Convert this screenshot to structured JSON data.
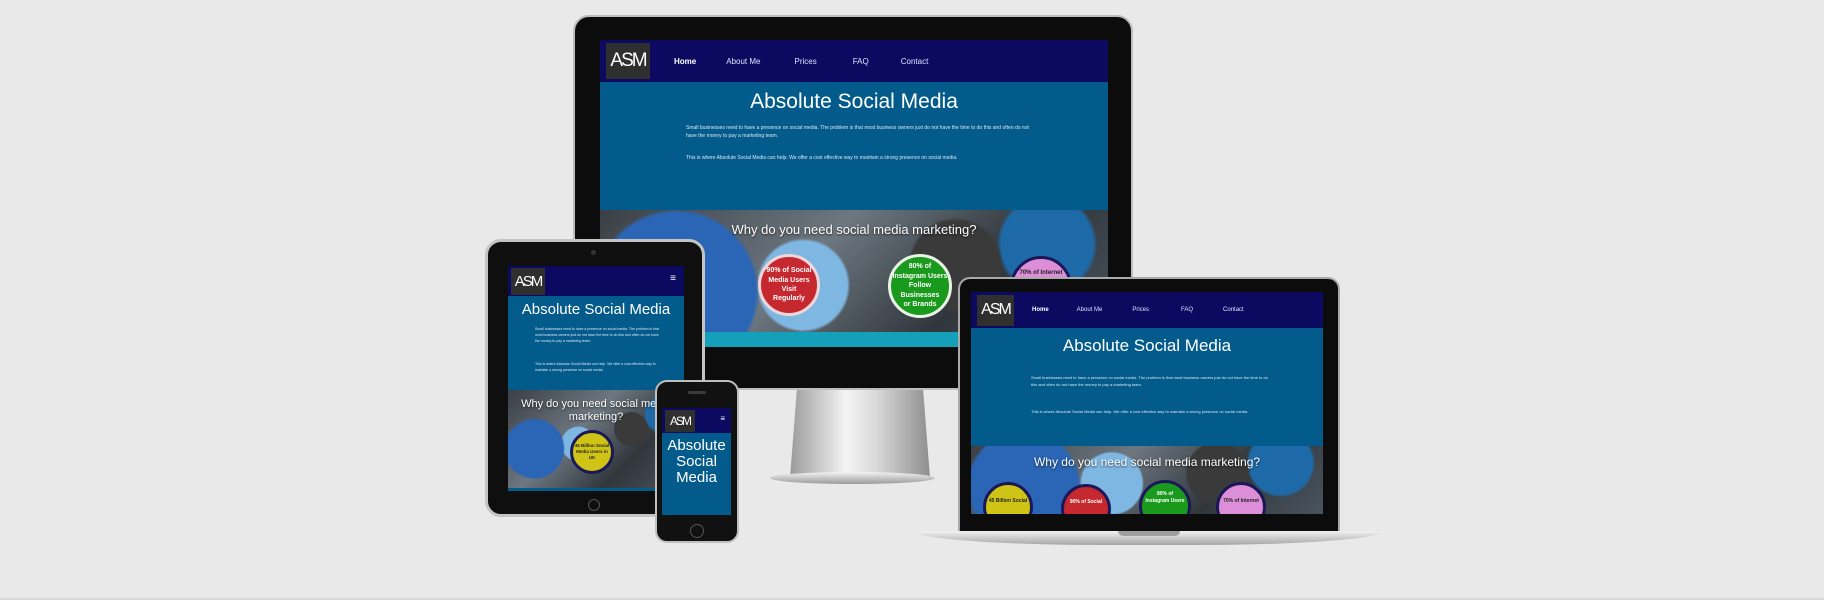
{
  "site": {
    "logo": "ASM",
    "title": "Absolute Social Media",
    "title_lines": [
      "Absolute",
      "Social",
      "Media"
    ],
    "why_title": "Why do you need social media marketing?",
    "why_title_l1": "Why do you need social media",
    "why_title_l2": "marketing?",
    "nav": [
      "Home",
      "About Me",
      "Prices",
      "FAQ",
      "Contact"
    ],
    "hamburger": "≡",
    "p1": "Small businesses need to have a presence on social media. The problem is that most business owners just do not have the time to do this and often do not have the money to pay a marketing team.",
    "p2": "This is where Absolute Social Media can help. We offer a cost effective way to maintain a strong presence on social media.",
    "stats": {
      "visit": [
        "90% of Social",
        "Media Users Visit",
        "Regularly"
      ],
      "follow": [
        "80% of",
        "Instagram Users",
        "Follow",
        "Businesses",
        "or Brands"
      ],
      "internet": [
        "70% of Internet"
      ],
      "billion": [
        "45 Billion Social",
        "Media Users in UK"
      ],
      "billion_short": [
        "45 Billion Social"
      ],
      "social_short": [
        "90% of Social"
      ],
      "insta_short": [
        "80% of",
        "Instagram Users"
      ],
      "internet_short": [
        "70% of Internet"
      ]
    }
  },
  "colors": {
    "nav_bg": "#0b0a60",
    "hero_bg": "#035b8b",
    "accent_teal": "#14a0b8"
  }
}
